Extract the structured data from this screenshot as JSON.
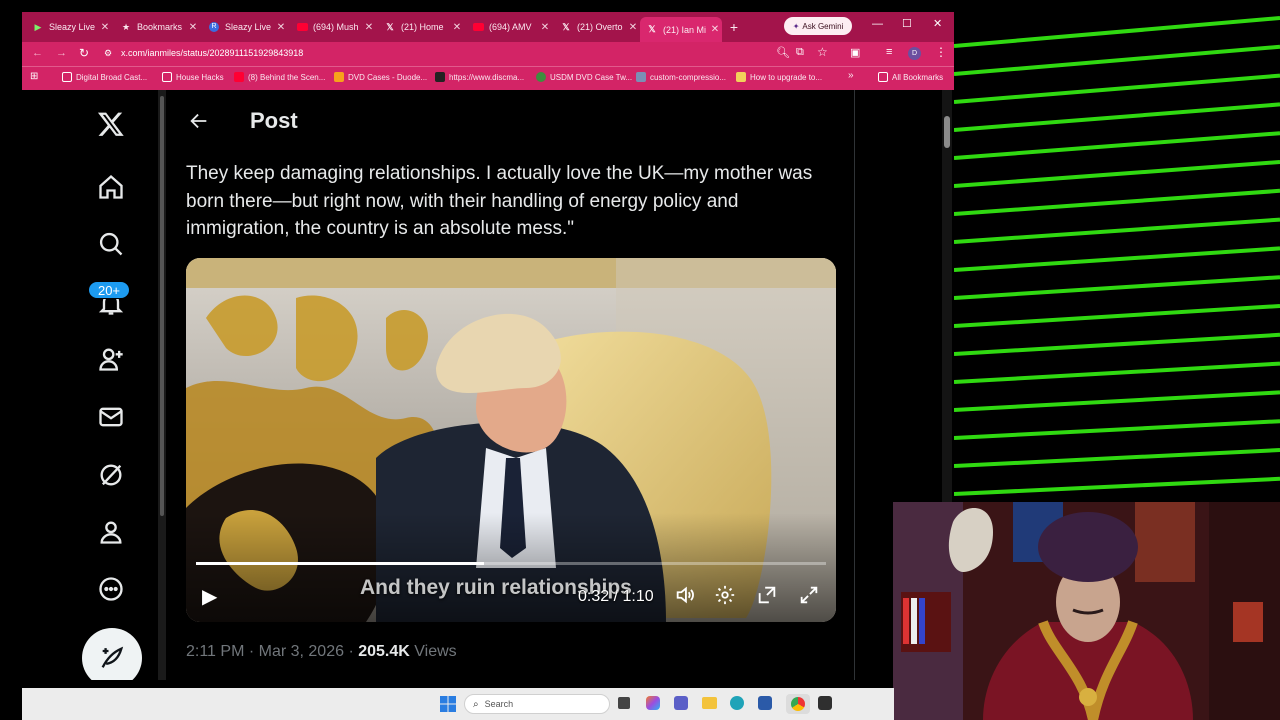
{
  "browser": {
    "tabs": [
      {
        "label": "Sleazy Live",
        "icon": "play-icon",
        "active": false
      },
      {
        "label": "Bookmarks",
        "icon": "star-icon",
        "active": false
      },
      {
        "label": "Sleazy Live",
        "icon": "r-icon",
        "active": false
      },
      {
        "label": "(694) Mush",
        "icon": "youtube-icon",
        "active": false
      },
      {
        "label": "(21) Home",
        "icon": "x-logo-icon",
        "active": false
      },
      {
        "label": "(694) AMV",
        "icon": "youtube-icon",
        "active": false
      },
      {
        "label": "(21) Overto",
        "icon": "x-logo-icon",
        "active": false
      },
      {
        "label": "(21) Ian Mi",
        "icon": "x-logo-icon",
        "active": true
      }
    ],
    "new_tab": "+",
    "ask_gemini": "Ask Gemini",
    "window_controls": {
      "minimize": "—",
      "maximize": "☐",
      "close": "✕"
    },
    "url": "x.com/ianmiles/status/2028911151929843918",
    "profile_initial": "D",
    "bookmarks": [
      {
        "label": "Digital Broad Cast..."
      },
      {
        "label": "House Hacks"
      },
      {
        "label": "(8) Behind the Scen..."
      },
      {
        "label": "DVD Cases - Duode..."
      },
      {
        "label": "https://www.discma..."
      },
      {
        "label": "USDM DVD Case Tw..."
      },
      {
        "label": "custom-compressio..."
      },
      {
        "label": "How to upgrade to..."
      }
    ],
    "bookmarks_overflow": "»",
    "all_bookmarks": "All Bookmarks"
  },
  "x": {
    "notifications_badge": "20+",
    "post_heading": "Post",
    "back_icon": "arrow-left-icon",
    "tweet_text": "They keep damaging relationships. I actually love the UK—my mother was born there—but right now, with their handling of energy policy and immigration, the country is an absolute mess.\"",
    "video": {
      "caption": "And they ruin relationships",
      "current_time": "0:32",
      "separator": " / ",
      "duration": "1:10",
      "progress": 0.457
    },
    "timestamp": "2:11 PM · Mar 3, 2026 · ",
    "views_count": "205.4K",
    "views_label": " Views"
  },
  "taskbar": {
    "search_placeholder": "Search"
  },
  "colors": {
    "tab_bar": "#a3144b",
    "toolbar": "#d32466",
    "x_blue": "#1d9bf0",
    "stripe_green": "#39ff14"
  }
}
